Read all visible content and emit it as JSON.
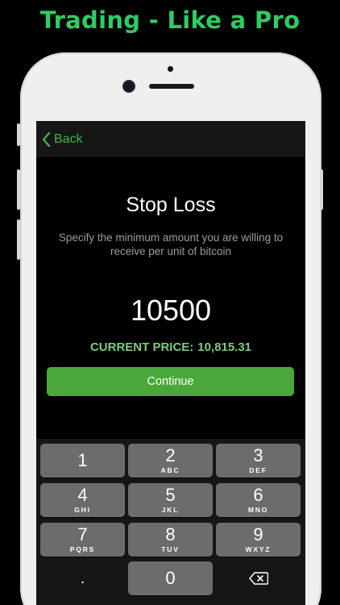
{
  "promo": {
    "title": "Trading - Like a Pro"
  },
  "nav": {
    "back_label": "Back"
  },
  "stop_loss": {
    "title": "Stop Loss",
    "description": "Specify the minimum amount you are willing to receive per unit of bitcoin",
    "amount": "10500",
    "current_price_label": "CURRENT PRICE:",
    "current_price_value": "10,815.31",
    "continue_label": "Continue"
  },
  "keypad": {
    "keys": [
      {
        "digit": "1",
        "letters": ""
      },
      {
        "digit": "2",
        "letters": "ABC"
      },
      {
        "digit": "3",
        "letters": "DEF"
      },
      {
        "digit": "4",
        "letters": "GHI"
      },
      {
        "digit": "5",
        "letters": "JKL"
      },
      {
        "digit": "6",
        "letters": "MNO"
      },
      {
        "digit": "7",
        "letters": "PQRS"
      },
      {
        "digit": "8",
        "letters": "TUV"
      },
      {
        "digit": "9",
        "letters": "WXYZ"
      },
      {
        "digit": ".",
        "letters": ""
      },
      {
        "digit": "0",
        "letters": ""
      }
    ],
    "delete_icon": "backspace-icon"
  },
  "colors": {
    "promo_green": "#2ecc63",
    "accent_green": "#4aa83b",
    "price_green": "#7fcb80",
    "back_green": "#46b046",
    "key_gray": "#6c6c6c"
  }
}
